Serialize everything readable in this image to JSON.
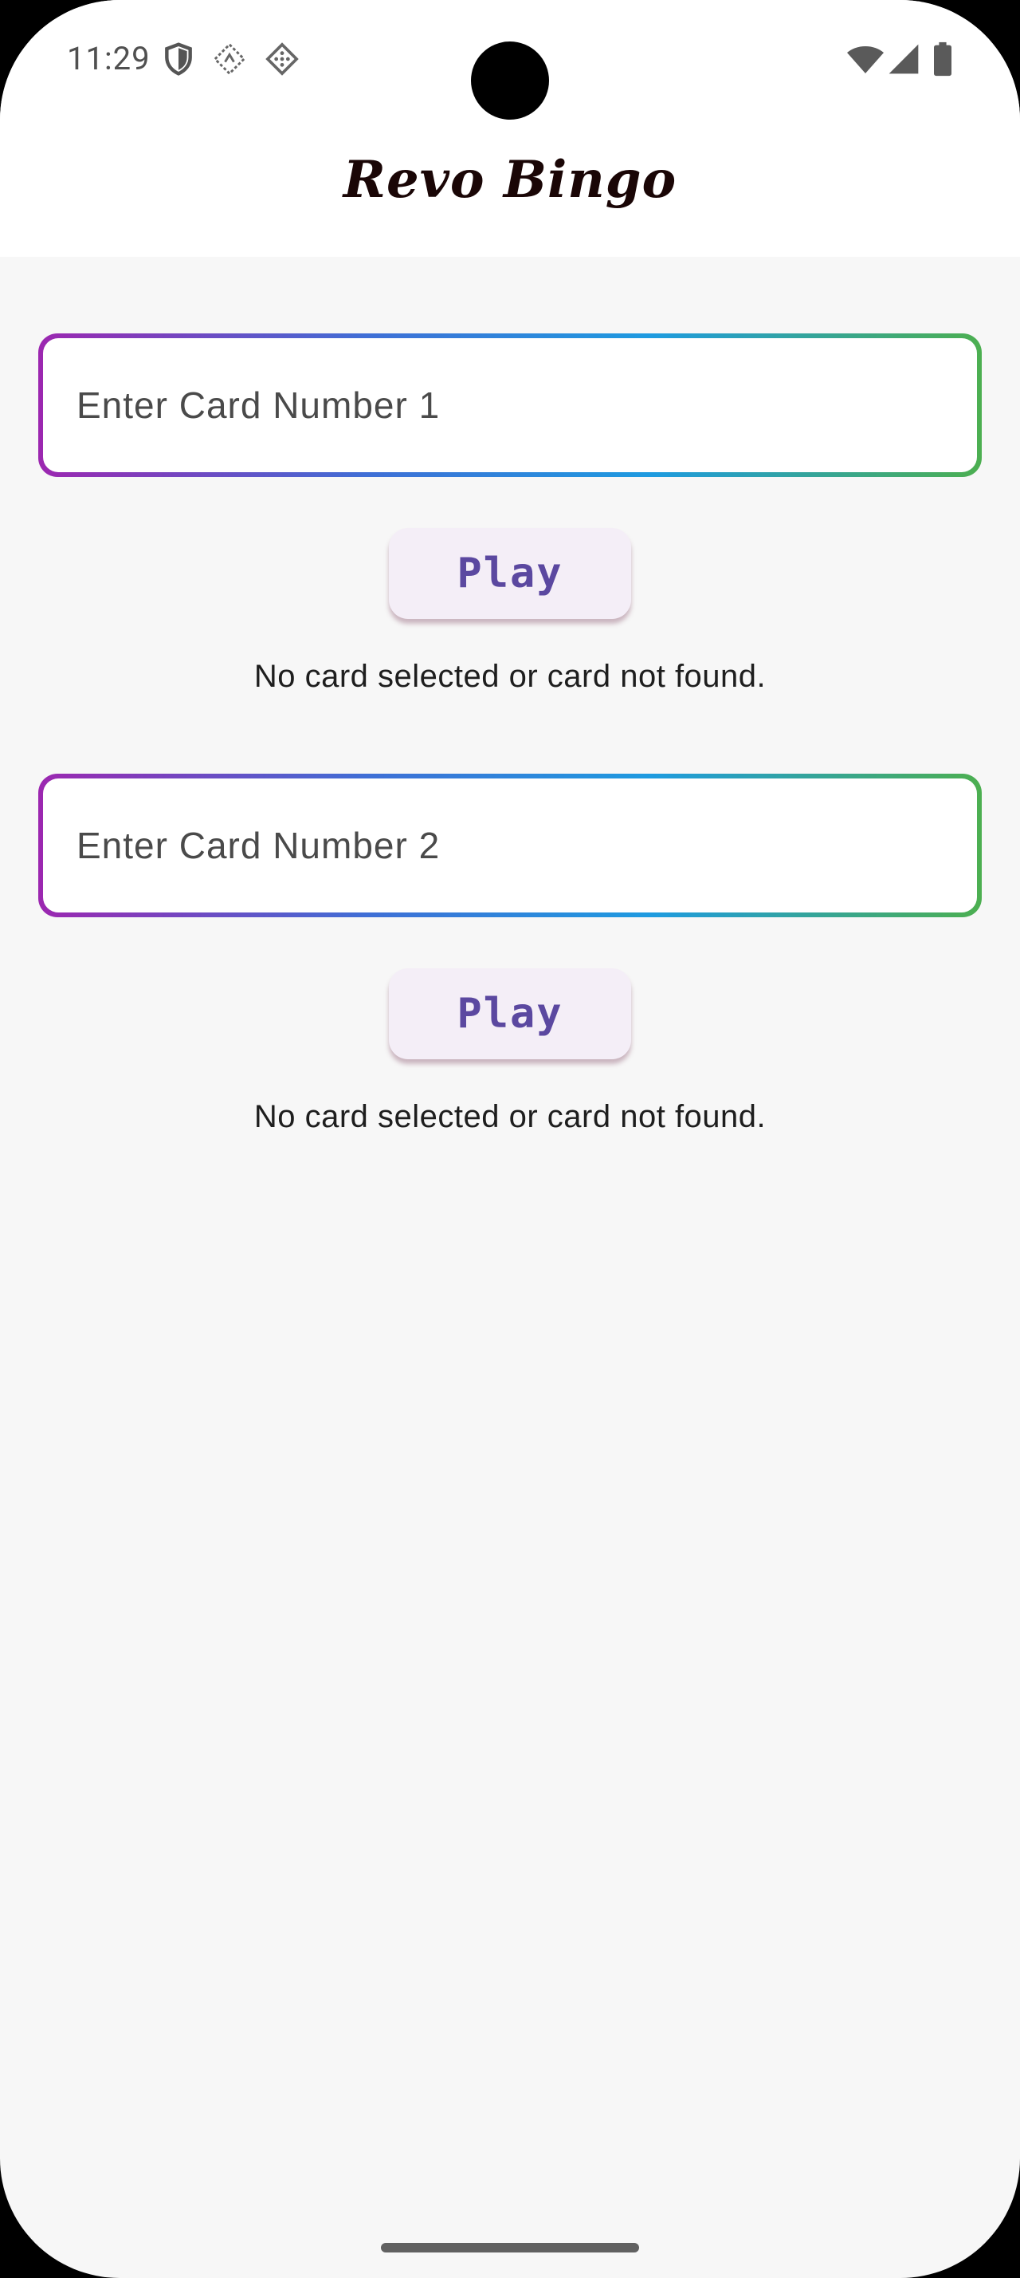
{
  "status_bar": {
    "time": "11:29",
    "left_icons": [
      "shield-icon",
      "sync-diamond-icon",
      "dice-icon"
    ],
    "right_icons": [
      "wifi-icon",
      "signal-icon",
      "battery-icon"
    ]
  },
  "app_bar": {
    "title": "Revo Bingo"
  },
  "cards": [
    {
      "input_placeholder": "Enter Card Number 1",
      "input_value": "",
      "button_label": "Play",
      "status_text": "No card selected or card not found."
    },
    {
      "input_placeholder": "Enter Card Number 2",
      "input_value": "",
      "button_label": "Play",
      "status_text": "No card selected or card not found."
    }
  ],
  "colors": {
    "gradient": [
      "#9c27b0",
      "#3f6fd6",
      "#1e9be0",
      "#4caf50"
    ],
    "button_bg": "#f4eef7",
    "button_text": "#5b48a0",
    "background": "#f7f7f7"
  }
}
